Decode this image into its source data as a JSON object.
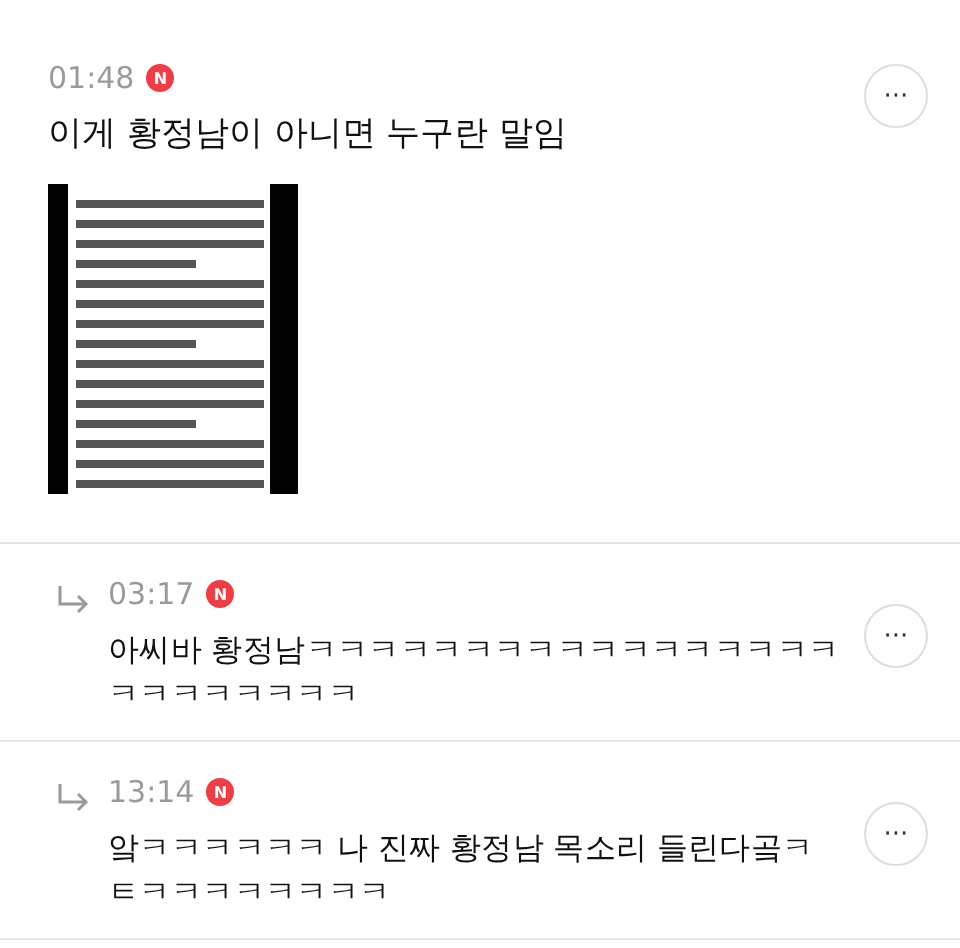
{
  "comments": [
    {
      "kind": "comment",
      "time": "01:48",
      "badge": "N",
      "lines": [
        "이게 황정남이 아니면 누구란 말임"
      ],
      "attachment": {
        "kind": "picture"
      },
      "more": "···"
    },
    {
      "kind": "reply",
      "time": "03:17",
      "badge": "N",
      "lines": [
        "아씨바 황정남ㅋㅋㅋㅋㅋㅋㅋㅋㅋㅋㅋㅋㅋㅋㅋㅋㅋ",
        "ㅋㅋㅋㅋㅋㅋㅋㅋ"
      ],
      "more": "···"
    },
    {
      "kind": "reply",
      "time": "13:14",
      "badge": "N",
      "lines": [
        "앜ㅋㅋㅋㅋㅋㅋ 나 진짜 황정남 목소리 들린다곸ㅋ",
        "ㅌㅋㅋㅋㅋㅋㅋㅋㅋ"
      ],
      "more": "···"
    }
  ]
}
